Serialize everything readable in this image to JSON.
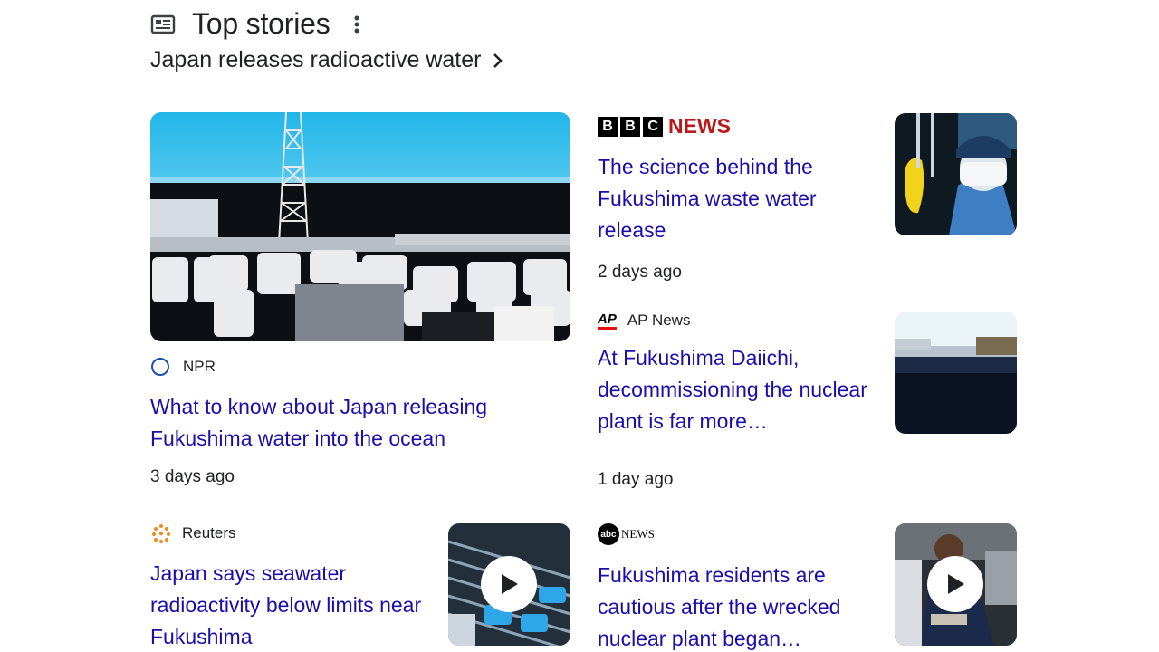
{
  "header": {
    "title": "Top stories",
    "icon": "news-icon",
    "menu_icon": "more-vert-icon"
  },
  "topic": {
    "label": "Japan releases radioactive water",
    "icon": "chevron-right-icon"
  },
  "stories": [
    {
      "source": "NPR",
      "headline": "What to know about Japan releasing Fukushima water into the ocean",
      "time": "3 days ago",
      "thumbnail": "fukushima-plant-tanks-image"
    },
    {
      "source_logo": {
        "letters": [
          "B",
          "B",
          "C"
        ],
        "word": "NEWS"
      },
      "headline": "The science behind the Fukushima waste water release",
      "time": "2 days ago",
      "thumbnail": "worker-in-protective-gear-image"
    },
    {
      "source": "AP News",
      "source_logo": "AP",
      "headline": "At Fukushima Daiichi, decommissioning the nuclear plant is far more…",
      "time": "1 day ago",
      "thumbnail": "coastline-plant-image"
    },
    {
      "source": "Reuters",
      "headline": "Japan says seawater radioactivity below limits near Fukushima",
      "thumbnail": "tanks-video-thumbnail",
      "video": true
    },
    {
      "source_logo": {
        "circle": "abc",
        "word": "NEWS"
      },
      "headline": "Fukushima residents are cautious after the wrecked nuclear plant began…",
      "thumbnail": "resident-video-thumbnail",
      "video": true
    }
  ],
  "colors": {
    "link": "#1a0dab",
    "bbc_red": "#bb1919",
    "ap_red": "#e3120b"
  }
}
